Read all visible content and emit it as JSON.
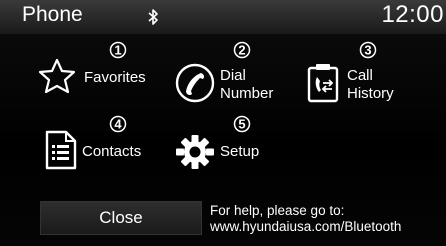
{
  "header": {
    "title": "Phone",
    "time": "12:00",
    "status_icon": "bluetooth-icon"
  },
  "menu": [
    {
      "number": "1",
      "label": "Favorites",
      "icon": "star-icon"
    },
    {
      "number": "2",
      "label_line1": "Dial",
      "label_line2": "Number",
      "icon": "dial-handset-icon"
    },
    {
      "number": "3",
      "label_line1": "Call",
      "label_line2": "History",
      "icon": "call-history-icon"
    },
    {
      "number": "4",
      "label": "Contacts",
      "icon": "contacts-document-icon"
    },
    {
      "number": "5",
      "label": "Setup",
      "icon": "gear-icon"
    }
  ],
  "footer": {
    "close_label": "Close",
    "help_line1": "For help, please go to:",
    "help_line2": "www.hyundaiusa.com/Bluetooth"
  }
}
